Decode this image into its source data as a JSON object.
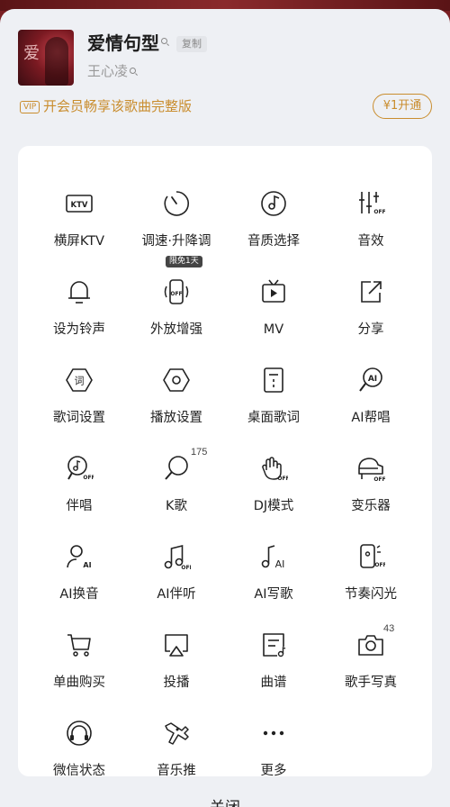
{
  "song": {
    "title": "爱情句型",
    "copy_label": "复制",
    "artist": "王心凌",
    "cover_mark": "爱"
  },
  "vip": {
    "badge": "VIP",
    "text": "开会员畅享该歌曲完整版",
    "button": "¥1开通"
  },
  "grid": {
    "ktv": "横屏KTV",
    "speed": "调速·升降调",
    "quality": "音质选择",
    "effects": "音效",
    "ringtone": "设为铃声",
    "amplify": "外放增强",
    "amplify_tag": "限免1天",
    "mv": "MV",
    "share": "分享",
    "lyric_settings": "歌词设置",
    "play_settings": "播放设置",
    "desktop_lyrics": "桌面歌词",
    "ai_chorus": "AI帮唱",
    "accompany": "伴唱",
    "karaoke": "K歌",
    "karaoke_count": "175",
    "dj_mode": "DJ模式",
    "voice_changer": "变乐器",
    "ai_voice": "AI换音",
    "ai_accompany": "AI伴听",
    "ai_compose": "AI写歌",
    "rhythm_flash": "节奏闪光",
    "buy_single": "单曲购买",
    "cast": "投播",
    "score": "曲谱",
    "artist_photo": "歌手写真",
    "artist_photo_count": "43",
    "wechat_status": "微信状态",
    "music_promote": "音乐推",
    "more": "更多"
  },
  "icons": {
    "ktv_text": "KTV",
    "off_text": "OFF",
    "ai_text": "AI",
    "lyric_char": "词"
  },
  "close_label": "关闭",
  "colors": {
    "accent_gold": "#c98d2e",
    "background": "#eef0f4",
    "card": "#ffffff"
  }
}
